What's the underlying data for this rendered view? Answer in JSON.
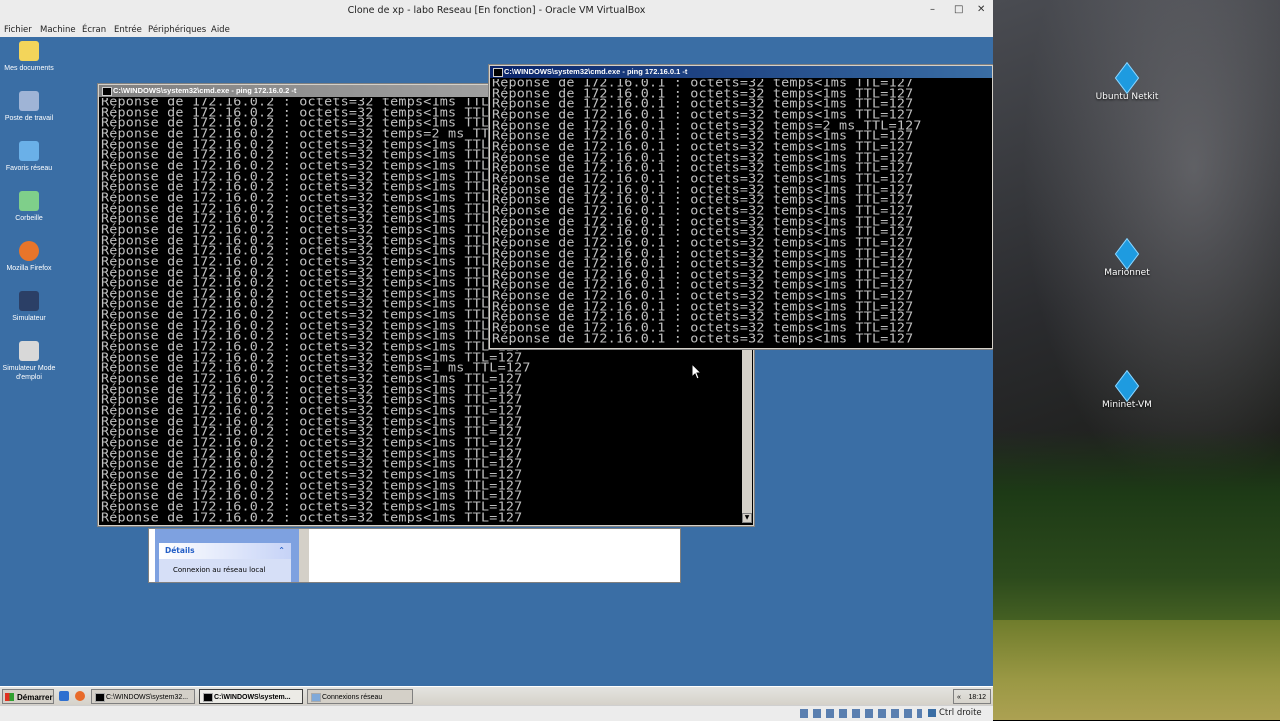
{
  "vbox": {
    "title": "Clone de xp - labo Reseau [En fonction] - Oracle VM VirtualBox",
    "menu": [
      "Fichier",
      "Machine",
      "Écran",
      "Entrée",
      "Périphériques",
      "Aide"
    ],
    "status_host_key": "Ctrl droite"
  },
  "guest_desktop": {
    "icons": [
      {
        "label": "Mes documents"
      },
      {
        "label": "Poste de travail"
      },
      {
        "label": "Favoris réseau"
      },
      {
        "label": "Corbeille"
      },
      {
        "label": "Mozilla Firefox"
      },
      {
        "label": "Simulateur"
      },
      {
        "label": "Simulateur Mode d'emploi"
      }
    ]
  },
  "cmd_back": {
    "title": "C:\\WINDOWS\\system32\\cmd.exe - ping 172.16.0.2 -t",
    "lines": [
      "Réponse de 172.16.0.2 : octets=32 temps<1ms TTL=127",
      "Réponse de 172.16.0.2 : octets=32 temps<1ms TTL=127",
      "Réponse de 172.16.0.2 : octets=32 temps<1ms TTL=127",
      "Réponse de 172.16.0.2 : octets=32 temps=2 ms TTL=127",
      "Réponse de 172.16.0.2 : octets=32 temps<1ms TTL=127",
      "Réponse de 172.16.0.2 : octets=32 temps<1ms TTL=127",
      "Réponse de 172.16.0.2 : octets=32 temps<1ms TTL=127",
      "Réponse de 172.16.0.2 : octets=32 temps<1ms TTL=127",
      "Réponse de 172.16.0.2 : octets=32 temps<1ms TTL=127",
      "Réponse de 172.16.0.2 : octets=32 temps<1ms TTL=127",
      "Réponse de 172.16.0.2 : octets=32 temps<1ms TTL=127",
      "Réponse de 172.16.0.2 : octets=32 temps<1ms TTL=127",
      "Réponse de 172.16.0.2 : octets=32 temps<1ms TTL=127",
      "Réponse de 172.16.0.2 : octets=32 temps<1ms TTL=127",
      "Réponse de 172.16.0.2 : octets=32 temps<1ms TTL=127",
      "Réponse de 172.16.0.2 : octets=32 temps<1ms TTL=127",
      "Réponse de 172.16.0.2 : octets=32 temps<1ms TTL=127",
      "Réponse de 172.16.0.2 : octets=32 temps<1ms TTL=127",
      "Réponse de 172.16.0.2 : octets=32 temps<1ms TTL=127",
      "Réponse de 172.16.0.2 : octets=32 temps<1ms TTL=127",
      "Réponse de 172.16.0.2 : octets=32 temps<1ms TTL=127",
      "Réponse de 172.16.0.2 : octets=32 temps<1ms TTL=127",
      "Réponse de 172.16.0.2 : octets=32 temps<1ms TTL=127",
      "Réponse de 172.16.0.2 : octets=32 temps<1ms TTL=127",
      "Réponse de 172.16.0.2 : octets=32 temps<1ms TTL=127",
      "Réponse de 172.16.0.2 : octets=32 temps=1 ms TTL=127",
      "Réponse de 172.16.0.2 : octets=32 temps<1ms TTL=127",
      "Réponse de 172.16.0.2 : octets=32 temps<1ms TTL=127",
      "Réponse de 172.16.0.2 : octets=32 temps<1ms TTL=127",
      "Réponse de 172.16.0.2 : octets=32 temps<1ms TTL=127",
      "Réponse de 172.16.0.2 : octets=32 temps<1ms TTL=127",
      "Réponse de 172.16.0.2 : octets=32 temps<1ms TTL=127",
      "Réponse de 172.16.0.2 : octets=32 temps<1ms TTL=127",
      "Réponse de 172.16.0.2 : octets=32 temps<1ms TTL=127",
      "Réponse de 172.16.0.2 : octets=32 temps<1ms TTL=127",
      "Réponse de 172.16.0.2 : octets=32 temps<1ms TTL=127",
      "Réponse de 172.16.0.2 : octets=32 temps<1ms TTL=127",
      "Réponse de 172.16.0.2 : octets=32 temps<1ms TTL=127",
      "Réponse de 172.16.0.2 : octets=32 temps<1ms TTL=127",
      "Réponse de 172.16.0.2 : octets=32 temps<1ms TTL=127"
    ]
  },
  "cmd_front": {
    "title": "C:\\WINDOWS\\system32\\cmd.exe - ping 172.16.0.1 -t",
    "lines": [
      "Réponse de 172.16.0.1 : octets=32 temps<1ms TTL=127",
      "Réponse de 172.16.0.1 : octets=32 temps<1ms TTL=127",
      "Réponse de 172.16.0.1 : octets=32 temps<1ms TTL=127",
      "Réponse de 172.16.0.1 : octets=32 temps<1ms TTL=127",
      "Réponse de 172.16.0.1 : octets=32 temps=2 ms TTL=127",
      "Réponse de 172.16.0.1 : octets=32 temps<1ms TTL=127",
      "Réponse de 172.16.0.1 : octets=32 temps<1ms TTL=127",
      "Réponse de 172.16.0.1 : octets=32 temps<1ms TTL=127",
      "Réponse de 172.16.0.1 : octets=32 temps<1ms TTL=127",
      "Réponse de 172.16.0.1 : octets=32 temps<1ms TTL=127",
      "Réponse de 172.16.0.1 : octets=32 temps<1ms TTL=127",
      "Réponse de 172.16.0.1 : octets=32 temps<1ms TTL=127",
      "Réponse de 172.16.0.1 : octets=32 temps<1ms TTL=127",
      "Réponse de 172.16.0.1 : octets=32 temps<1ms TTL=127",
      "Réponse de 172.16.0.1 : octets=32 temps<1ms TTL=127",
      "Réponse de 172.16.0.1 : octets=32 temps<1ms TTL=127",
      "Réponse de 172.16.0.1 : octets=32 temps<1ms TTL=127",
      "Réponse de 172.16.0.1 : octets=32 temps<1ms TTL=127",
      "Réponse de 172.16.0.1 : octets=32 temps<1ms TTL=127",
      "Réponse de 172.16.0.1 : octets=32 temps<1ms TTL=127",
      "Réponse de 172.16.0.1 : octets=32 temps<1ms TTL=127",
      "Réponse de 172.16.0.1 : octets=32 temps<1ms TTL=127",
      "Réponse de 172.16.0.1 : octets=32 temps<1ms TTL=127",
      "Réponse de 172.16.0.1 : octets=32 temps<1ms TTL=127",
      "Réponse de 172.16.0.1 : octets=32 temps<1ms TTL=127"
    ]
  },
  "netconn": {
    "section_title": "Détails",
    "item": "Connexion au réseau local"
  },
  "taskbar": {
    "start_label": "Démarrer",
    "tasks": [
      {
        "label": "C:\\WINDOWS\\system32..."
      },
      {
        "label": "C:\\WINDOWS\\system..."
      },
      {
        "label": "Connexions réseau"
      }
    ],
    "clock": "18:12"
  },
  "host_desktop": {
    "icons": [
      {
        "label": "Ubuntu Netkit"
      },
      {
        "label": "Marionnet"
      },
      {
        "label": "Mininet-VM"
      }
    ]
  }
}
